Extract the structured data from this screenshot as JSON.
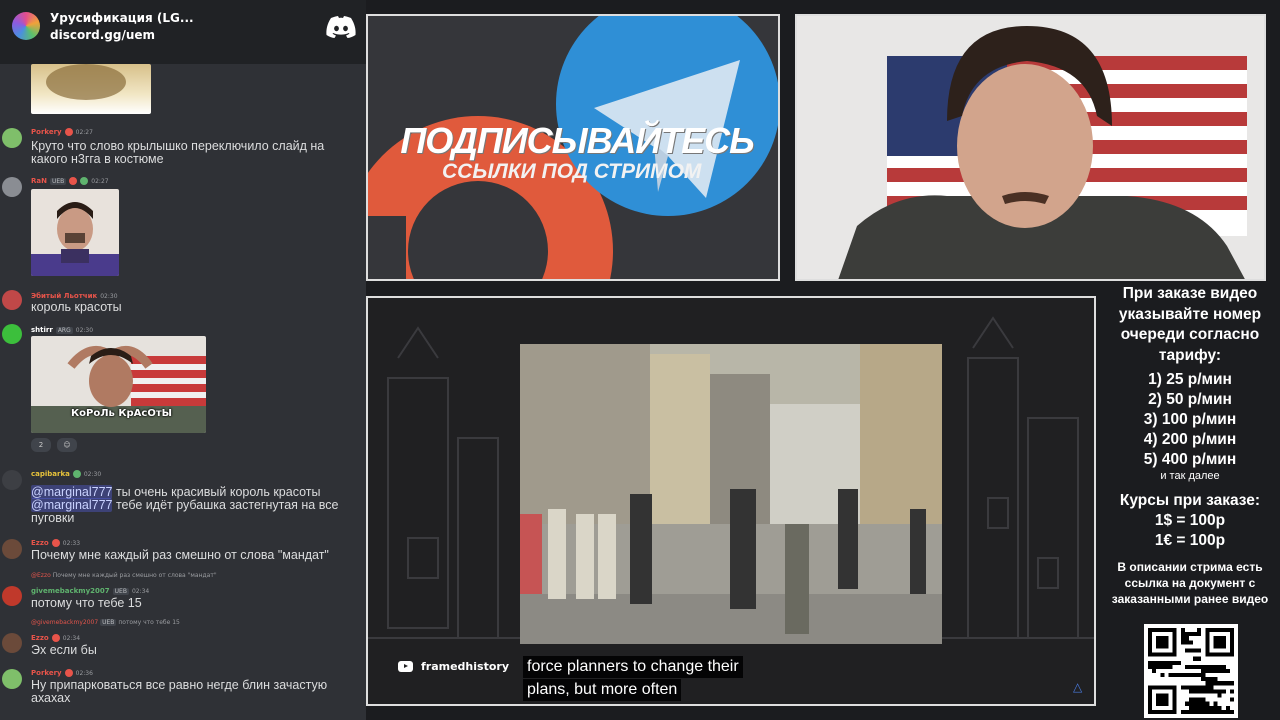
{
  "chat": {
    "server_name": "Урусификация (LG...",
    "server_invite": "discord.gg/uem",
    "messages": [
      {
        "id": "m1",
        "user": "Porkery",
        "user_color": "#e8544a",
        "time": "02:27",
        "text": "Круто что слово крылышко переключило слайд на какого н3гга в костюме"
      },
      {
        "id": "m2",
        "user": "RaN",
        "user_color": "#e8544a",
        "tag": "UEB",
        "time": "02:27"
      },
      {
        "id": "m3",
        "user": "Эбитый Льотчик",
        "user_color": "#e8544a",
        "time": "02:30",
        "text": "король красоты"
      },
      {
        "id": "m4",
        "user": "shtirr",
        "user_color": "#ffffff",
        "tag": "ARG",
        "time": "02:30",
        "image_caption": "КоРоЛь КрАсОтЫ",
        "reaction_count": "2"
      },
      {
        "id": "m5",
        "user": "capibarka",
        "user_color": "#e7c33b",
        "time": "02:30",
        "line1_mention": "@marginal777",
        "line1_text": " ты очень красивый король красоты",
        "line2_mention": "@marginal777",
        "line2_text": " тебе идёт рубашка застегнутая на все пуговки"
      },
      {
        "id": "m6",
        "user": "Ezzo",
        "user_color": "#e8544a",
        "time": "02:33",
        "text": "Почему мне каждый раз смешно от слова \"мандат\""
      },
      {
        "id": "m7",
        "reply_user": "@Ezzo",
        "reply_text": "Почему мне каждый раз смешно от слова \"мандат\"",
        "user": "givemebackmy2007",
        "user_color": "#5fb36e",
        "tag": "UEB",
        "time": "02:34",
        "text": "потому что тебе 15"
      },
      {
        "id": "m8",
        "reply_user": "@givemebackmy2007",
        "reply_tag": "UEB",
        "reply_text": "потому что тебе 15",
        "user": "Ezzo",
        "user_color": "#e8544a",
        "time": "02:34",
        "text": "Эх если бы"
      },
      {
        "id": "m9",
        "user": "Porkery",
        "user_color": "#e8544a",
        "time": "02:36",
        "text": "Ну припарковаться все равно негде блин зачастую ахахах"
      }
    ]
  },
  "promo": {
    "title": "ПОДПИСЫВАЙТЕСЬ",
    "subtitle": "ССЫЛКИ ПОД СТРИМОМ",
    "colors": {
      "patreon": "#e05a3c",
      "telegram": "#2f8fd6"
    }
  },
  "video": {
    "channel": "framedhistory",
    "subtitle_line1": "force planners to change their",
    "subtitle_line2": "plans, but more often"
  },
  "info": {
    "heading": "При заказе видео указывайте номер очереди согласно тарифу:",
    "tariffs": [
      "1) 25 р/мин",
      "2) 50 р/мин",
      "3) 100 р/мин",
      "4) 200 р/мин",
      "5) 400 р/мин"
    ],
    "tariffs_etc": "и так далее",
    "rates_title": "Курсы при заказе:",
    "rate1": "1$ = 100р",
    "rate2": "1€ = 100р",
    "description": "В описании стрима есть ссылка на документ с заказанными ранее видео"
  }
}
